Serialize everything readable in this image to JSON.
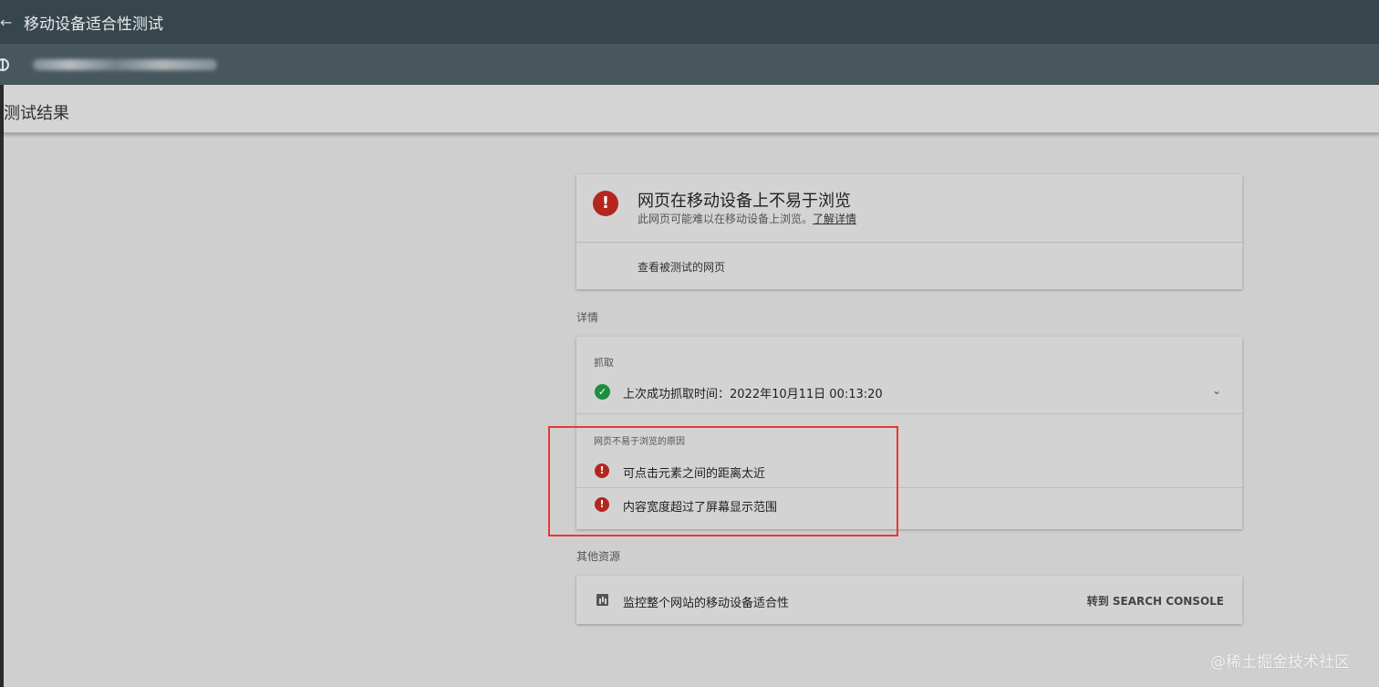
{
  "app": {
    "title": "移动设备适合性测试",
    "back_icon": "←"
  },
  "url_bar": {
    "icon": "globe-icon",
    "url_text": ""
  },
  "page": {
    "title": "测试结果"
  },
  "summary": {
    "icon": "!",
    "title": "网页在移动设备上不易于浏览",
    "subtitle": "此网页可能难以在移动设备上浏览。",
    "learn_more": "了解详情",
    "view_tested_page": "查看被测试的网页"
  },
  "details": {
    "section_label": "详情",
    "fetch_label": "抓取",
    "fetch_status": "上次成功抓取时间：2022年10月11日 00:13:20",
    "issues_label": "网页不易于浏览的原因",
    "issues": [
      "可点击元素之间的距离太近",
      "内容宽度超过了屏幕显示范围"
    ]
  },
  "resources": {
    "section_label": "其他资源",
    "item": "监控整个网站的移动设备适合性",
    "link": "转到 SEARCH CONSOLE"
  },
  "watermark": "@稀土掘金技术社区",
  "colors": {
    "topbar": "#37464c",
    "urlbar": "#48575d",
    "error": "#b3261e",
    "success": "#1e8e3e",
    "highlight": "#e53935"
  }
}
